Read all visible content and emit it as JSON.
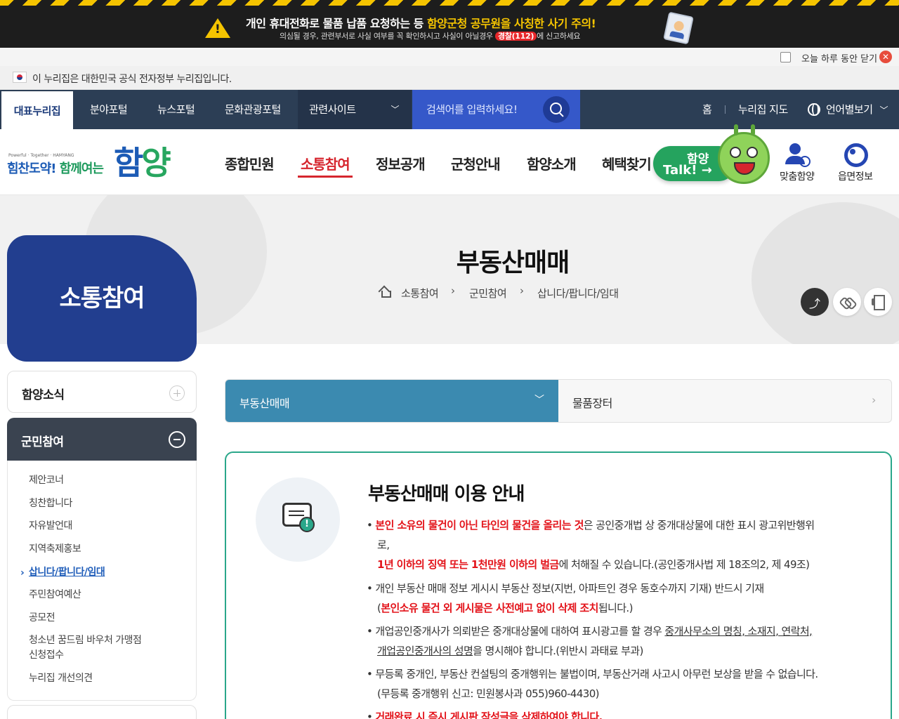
{
  "alert": {
    "line1_a": "개인 휴대전화로 물품 납품 요청하는 등 ",
    "line1_b": "함양군청 공무원을 사칭한 사기 주의!",
    "line2_a": "의심될 경우, 관련부서로 사실 여부를 꼭 확인하시고 사실이 아닐경우 ",
    "line2_badge": "경찰(112)",
    "line2_b": "에 신고하세요"
  },
  "close_today": {
    "label": "오늘 하루 동안 닫기",
    "checked": false
  },
  "gov_notice": "이 누리집은 대한민국 공식 전자정부 누리집입니다.",
  "topnav": {
    "items": [
      "대표누리집",
      "분야포털",
      "뉴스포털",
      "문화관광포털",
      "관련사이트"
    ],
    "search_placeholder": "검색어를 입력하세요!",
    "home": "홈",
    "sitemap": "누리집 지도",
    "language": "언어별보기"
  },
  "header": {
    "logo_small": "Powerful · Together · HAMYANG",
    "slogan_a": "힘찬도약! ",
    "slogan_b": "함께여는",
    "logo_a": "함",
    "logo_b": "양",
    "gnb": [
      "종합민원",
      "소통참여",
      "정보공개",
      "군청안내",
      "함양소개",
      "혜택찾기"
    ],
    "active_gnb": "소통참여",
    "talk_top": "함양",
    "talk_bottom": "Talk! →",
    "quick1": "맞춤함양",
    "quick2": "읍면정보"
  },
  "visual": {
    "section_title": "소통참여",
    "page_title": "부동산매매",
    "breadcrumb": [
      "소통참여",
      "군민참여",
      "삽니다/팝니다/임대"
    ]
  },
  "sidebar": {
    "menu1": "함양소식",
    "menu2": "군민참여",
    "subitems": [
      "제안코너",
      "칭찬합니다",
      "자유발언대",
      "지역축제홍보",
      "삽니다/팝니다/임대",
      "주민참여예산",
      "공모전",
      "청소년 꿈드림 바우처 가맹점",
      "신청접수",
      "누리집 개선의견"
    ],
    "active_subitem": "삽니다/팝니다/임대"
  },
  "tabs": {
    "tab1": "부동산매매",
    "tab2": "물품장터"
  },
  "info": {
    "title": "부동산매매 이용 안내",
    "b1_red": "본인 소유의 물건이 아닌 타인의 물건을 올리는 것",
    "b1_rest": "은 공인중개법 상 중개대상물에 대한 표시 광고위반행위",
    "b1_cont": "로,",
    "b1_red2": "1년 이하의 징역 또는 1천만원 이하의 벌금",
    "b1_rest2": "에 처해질 수 있습니다.(공인중개사법 제 18조의2, 제 49조)",
    "b2_a": "개인 부동산 매매 정보 게시시 부동산 정보(지번, 아파트인 경우 동호수까지 기재) 반드시 기재",
    "b2_b1": "(",
    "b2_red": "본인소유 물건 외 게시물은 사전예고 없이 삭제 조치",
    "b2_b2": "됩니다.)",
    "b3_a": "개업공인중개사가 의뢰받은 중개대상물에 대하여 표시광고를 할 경우 ",
    "b3_u1": "중개사무소의 명칭, 소재지, 연락처,",
    "b3_u2": "개업공인중개사의 성명",
    "b3_b": "을 명시해야 합니다.(위반시 과태료 부과)",
    "b4_a": "무등록 중개인, 부동산 컨설팅의 중개행위는 불법이며, 부동산거래 사고시 아무런 보상을 받을 수 없습니다.",
    "b4_b": "(무등록 중개행위 신고: 민원봉사과 055)960-4430)",
    "b5_red": "거래완료 시 즉시 게시판 작성글을 삭제하여야 합니다."
  },
  "colors": {
    "accent_blue": "#223e8f",
    "accent_red": "#d6262e",
    "tab_teal": "#3b8ab0",
    "box_green": "#2aa78a"
  }
}
